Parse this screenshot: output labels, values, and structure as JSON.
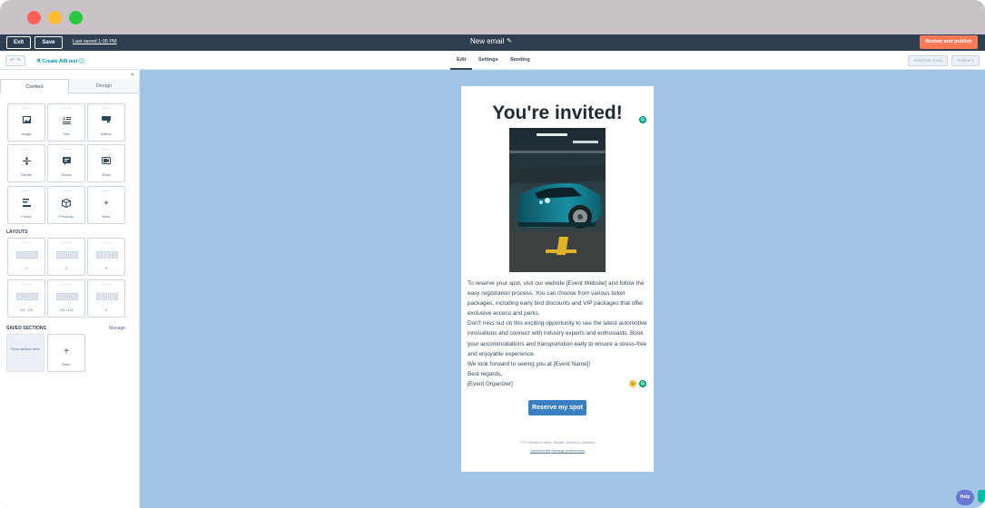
{
  "topbar": {
    "exit_label": "Exit",
    "save_label": "Save",
    "last_saved": "Last saved 1:05 PM",
    "email_title": "New email",
    "review_label": "Review and publish"
  },
  "toolbar": {
    "undo_redo": "↶ ↷",
    "ab_test": "Create A/B test",
    "tabs": [
      "Edit",
      "Settings",
      "Sending"
    ],
    "send_test": "Send test email",
    "actions": "Actions ▾"
  },
  "sidebar": {
    "tabs": [
      "Content",
      "Design"
    ],
    "content_modules": [
      {
        "label": "Image",
        "icon": "image-icon"
      },
      {
        "label": "Text",
        "icon": "text-icon"
      },
      {
        "label": "Button",
        "icon": "button-icon"
      },
      {
        "label": "Divider",
        "icon": "divider-icon"
      },
      {
        "label": "Social",
        "icon": "social-icon"
      },
      {
        "label": "Video",
        "icon": "video-icon"
      },
      {
        "label": "Footer",
        "icon": "footer-icon"
      },
      {
        "label": "Products",
        "icon": "products-icon"
      },
      {
        "label": "More",
        "icon": "plus-icon"
      }
    ],
    "layouts_heading": "LAYOUTS",
    "layouts": [
      "1",
      "2",
      "3",
      "1/3 : 2/3",
      "2/3 : 1/3",
      "4"
    ],
    "saved_heading": "SAVED SECTIONS",
    "manage_label": "Manage",
    "drop_label": "Drop section here",
    "more_label": "More"
  },
  "email": {
    "headline": "You're invited!",
    "paragraphs": [
      "To reserve your spot, visit our website [Event Website] and follow the easy registration process. You can choose from various ticket packages, including early bird discounts and VIP packages that offer exclusive access and perks.",
      "Don't miss out on this exciting opportunity to see the latest automotive innovations and connect with industry experts and enthusiasts. Book your accommodations and transportation early to ensure a stress-free and enjoyable experience.",
      "We look forward to seeing you at [Event Name]!",
      "Best regards,",
      "[Event Organizer]"
    ],
    "cta_label": "Reserve my spot",
    "footer_address": "YTG Media Limited, Seattle, America, America",
    "footer_unsubscribe": "Unsubscribe",
    "footer_manage": "Manage preferences"
  },
  "help_label": "Help",
  "colors": {
    "topbar": "#2d3e50",
    "accent": "#ff7a59",
    "canvas": "#a2c5e6",
    "cta": "#3a7fc1",
    "link": "#0091ae"
  }
}
